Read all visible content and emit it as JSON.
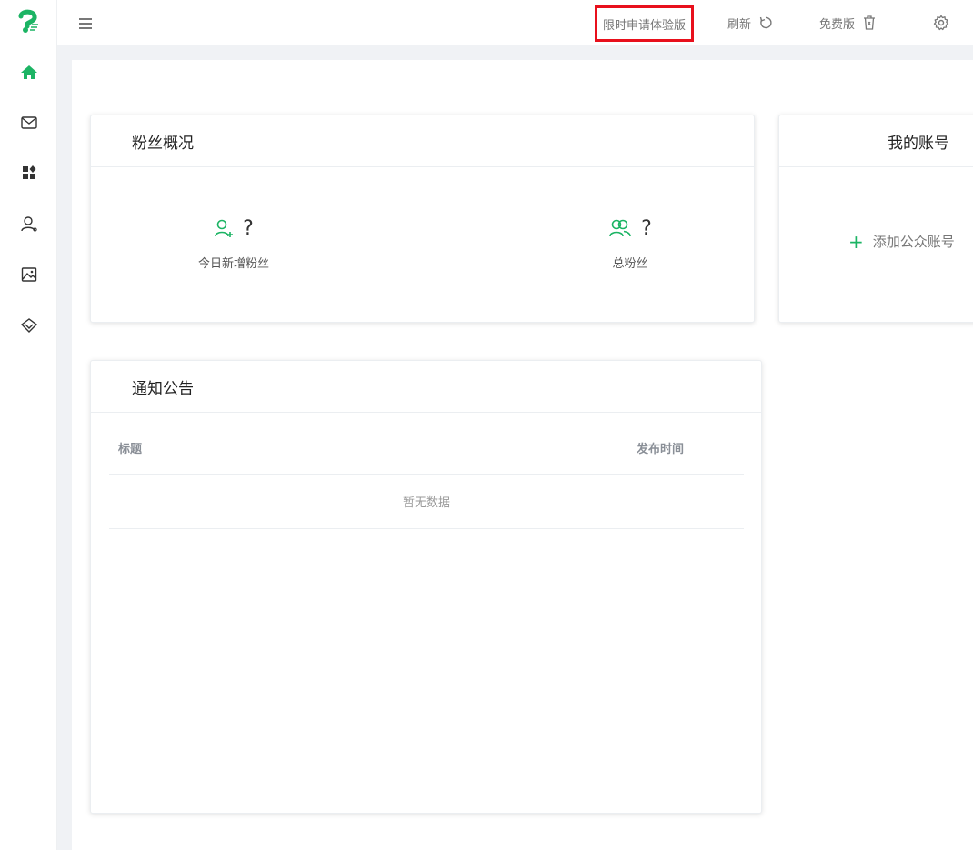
{
  "colors": {
    "accent": "#1cb464",
    "highlight_border": "#e8101c",
    "main_bg": "#f0f2f5"
  },
  "sidebar": {
    "logo": "parrot-logo-icon",
    "items": [
      {
        "icon": "home-icon",
        "active": true
      },
      {
        "icon": "mail-icon",
        "active": false
      },
      {
        "icon": "apps-icon",
        "active": false
      },
      {
        "icon": "user-icon",
        "active": false
      },
      {
        "icon": "image-icon",
        "active": false
      },
      {
        "icon": "diamond-icon",
        "active": false
      }
    ]
  },
  "header": {
    "menu_icon": "menu-icon",
    "trial_label": "限时申请体验版",
    "refresh_label": "刷新",
    "free_label": "免费版",
    "settings_icon": "gear-icon"
  },
  "fans_card": {
    "title": "粉丝概况",
    "today": {
      "value": "?",
      "label": "今日新增粉丝",
      "icon": "user-add-icon"
    },
    "total": {
      "value": "?",
      "label": "总粉丝",
      "icon": "users-icon"
    }
  },
  "account_card": {
    "title": "我的账号",
    "add_label": "添加公众账号"
  },
  "notice_card": {
    "title": "通知公告",
    "columns": [
      "标题",
      "发布时间"
    ],
    "empty_text": "暂无数据"
  }
}
